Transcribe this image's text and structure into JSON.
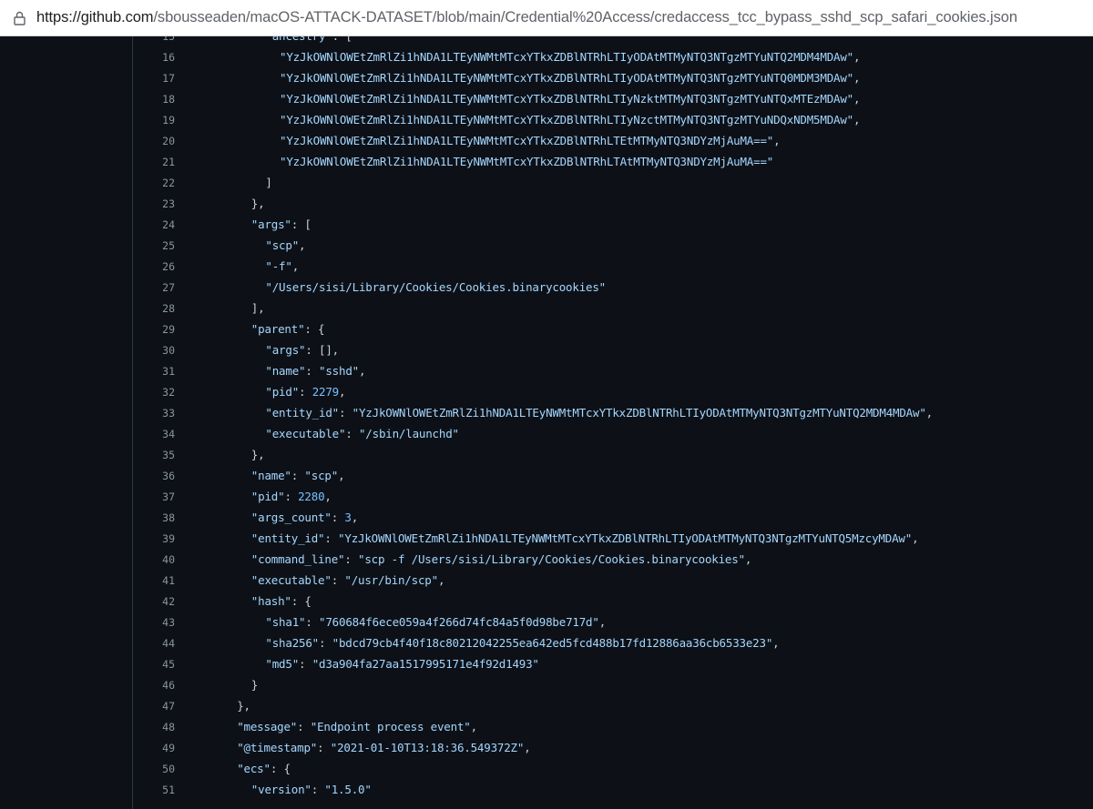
{
  "browser": {
    "url_domain": "https://github.com",
    "url_path": "/sbousseaden/macOS-ATTACK-DATASET/blob/main/Credential%20Access/credaccess_tcc_bypass_sshd_scp_safari_cookies.json",
    "lock_icon": "lock-icon"
  },
  "colors": {
    "background": "#0d1117",
    "line_number": "#8b949e",
    "string": "#a5d6ff",
    "number": "#79c0ff",
    "punctuation": "#c9d1d9"
  },
  "code_lines": [
    {
      "num": "15",
      "indent": 9,
      "text": "\"ancestry\": ["
    },
    {
      "num": "16",
      "indent": 10,
      "text": "\"YzJkOWNlOWEtZmRlZi1hNDA1LTEyNWMtMTcxYTkxZDBlNTRhLTIyODAtMTMyNTQ3NTgzMTYuNTQ2MDM4MDAw\","
    },
    {
      "num": "17",
      "indent": 10,
      "text": "\"YzJkOWNlOWEtZmRlZi1hNDA1LTEyNWMtMTcxYTkxZDBlNTRhLTIyODAtMTMyNTQ3NTgzMTYuNTQ0MDM3MDAw\","
    },
    {
      "num": "18",
      "indent": 10,
      "text": "\"YzJkOWNlOWEtZmRlZi1hNDA1LTEyNWMtMTcxYTkxZDBlNTRhLTIyNzktMTMyNTQ3NTgzMTYuNTQxMTEzMDAw\","
    },
    {
      "num": "19",
      "indent": 10,
      "text": "\"YzJkOWNlOWEtZmRlZi1hNDA1LTEyNWMtMTcxYTkxZDBlNTRhLTIyNzctMTMyNTQ3NTgzMTYuNDQxNDM5MDAw\","
    },
    {
      "num": "20",
      "indent": 10,
      "text": "\"YzJkOWNlOWEtZmRlZi1hNDA1LTEyNWMtMTcxYTkxZDBlNTRhLTEtMTMyNTQ3NDYzMjAuMA==\","
    },
    {
      "num": "21",
      "indent": 10,
      "text": "\"YzJkOWNlOWEtZmRlZi1hNDA1LTEyNWMtMTcxYTkxZDBlNTRhLTAtMTMyNTQ3NDYzMjAuMA==\""
    },
    {
      "num": "22",
      "indent": 9,
      "text": "]"
    },
    {
      "num": "23",
      "indent": 8,
      "text": "},"
    },
    {
      "num": "24",
      "indent": 8,
      "text": "\"args\": ["
    },
    {
      "num": "25",
      "indent": 9,
      "text": "\"scp\","
    },
    {
      "num": "26",
      "indent": 9,
      "text": "\"-f\","
    },
    {
      "num": "27",
      "indent": 9,
      "text": "\"/Users/sisi/Library/Cookies/Cookies.binarycookies\""
    },
    {
      "num": "28",
      "indent": 8,
      "text": "],"
    },
    {
      "num": "29",
      "indent": 8,
      "text": "\"parent\": {"
    },
    {
      "num": "30",
      "indent": 9,
      "text": "\"args\": [],"
    },
    {
      "num": "31",
      "indent": 9,
      "text": "\"name\": \"sshd\","
    },
    {
      "num": "32",
      "indent": 9,
      "text": "\"pid\": 2279,"
    },
    {
      "num": "33",
      "indent": 9,
      "text": "\"entity_id\": \"YzJkOWNlOWEtZmRlZi1hNDA1LTEyNWMtMTcxYTkxZDBlNTRhLTIyODAtMTMyNTQ3NTgzMTYuNTQ2MDM4MDAw\","
    },
    {
      "num": "34",
      "indent": 9,
      "text": "\"executable\": \"/sbin/launchd\""
    },
    {
      "num": "35",
      "indent": 8,
      "text": "},"
    },
    {
      "num": "36",
      "indent": 8,
      "text": "\"name\": \"scp\","
    },
    {
      "num": "37",
      "indent": 8,
      "text": "\"pid\": 2280,"
    },
    {
      "num": "38",
      "indent": 8,
      "text": "\"args_count\": 3,"
    },
    {
      "num": "39",
      "indent": 8,
      "text": "\"entity_id\": \"YzJkOWNlOWEtZmRlZi1hNDA1LTEyNWMtMTcxYTkxZDBlNTRhLTIyODAtMTMyNTQ3NTgzMTYuNTQ5MzcyMDAw\","
    },
    {
      "num": "40",
      "indent": 8,
      "text": "\"command_line\": \"scp -f /Users/sisi/Library/Cookies/Cookies.binarycookies\","
    },
    {
      "num": "41",
      "indent": 8,
      "text": "\"executable\": \"/usr/bin/scp\","
    },
    {
      "num": "42",
      "indent": 8,
      "text": "\"hash\": {"
    },
    {
      "num": "43",
      "indent": 9,
      "text": "\"sha1\": \"760684f6ece059a4f266d74fc84a5f0d98be717d\","
    },
    {
      "num": "44",
      "indent": 9,
      "text": "\"sha256\": \"bdcd79cb4f40f18c80212042255ea642ed5fcd488b17fd12886aa36cb6533e23\","
    },
    {
      "num": "45",
      "indent": 9,
      "text": "\"md5\": \"d3a904fa27aa1517995171e4f92d1493\""
    },
    {
      "num": "46",
      "indent": 8,
      "text": "}"
    },
    {
      "num": "47",
      "indent": 7,
      "text": "},"
    },
    {
      "num": "48",
      "indent": 7,
      "text": "\"message\": \"Endpoint process event\","
    },
    {
      "num": "49",
      "indent": 7,
      "text": "\"@timestamp\": \"2021-01-10T13:18:36.549372Z\","
    },
    {
      "num": "50",
      "indent": 7,
      "text": "\"ecs\": {"
    },
    {
      "num": "51",
      "indent": 8,
      "text": "\"version\": \"1.5.0\""
    }
  ]
}
